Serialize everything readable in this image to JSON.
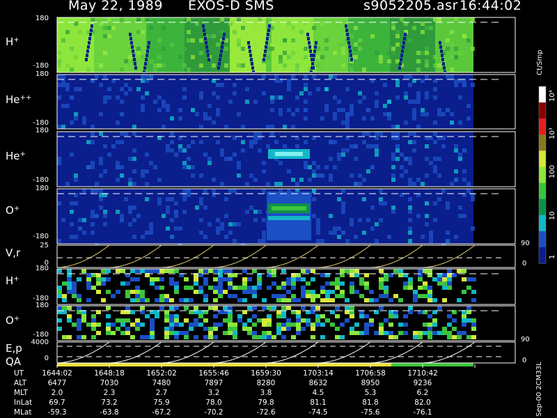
{
  "header": {
    "date": "May 22, 1989",
    "instrument": "EXOS-D SMS",
    "file": "s9052205.asr",
    "time": "16:44:02"
  },
  "panel_labels": {
    "h_plus": "H",
    "h_plus_sup": "+",
    "he_pp": "He",
    "he_pp_sup": "++",
    "he_plus": "He",
    "he_plus_sup": "+",
    "o_plus": "O",
    "o_plus_sup": "+",
    "vr": "V,r",
    "h_plus2": "H",
    "h_plus2_sup": "+",
    "o_plus2": "O",
    "o_plus2_sup": "+",
    "ep": "E,p",
    "qa": "QA"
  },
  "y_ticks": {
    "angle_top": "180",
    "angle_bottom": "-180",
    "vr_top": "25",
    "vr_bottom": "0",
    "ep_top": "4000",
    "ep_bottom": "0",
    "right_90": "90",
    "right_0": "0"
  },
  "colorbar": {
    "unit": "Ct/Smp",
    "labels": [
      "1",
      "10",
      "100",
      "10³",
      "10⁴"
    ],
    "colors": [
      "#0a1e8c",
      "#1b4fc4",
      "#12b7c8",
      "#0f8f4a",
      "#3cc43c",
      "#8ee63c",
      "#d6e83c",
      "#8a7a1e",
      "#e61e1e",
      "#8a0000",
      "#ffffff"
    ]
  },
  "footer": "Sep-00 2CM33L",
  "ephemeris": {
    "labels": [
      "UT",
      "ALT",
      "MLT",
      "InLat",
      "MLat"
    ],
    "columns": [
      {
        "UT": "1644:02",
        "ALT": "6477",
        "MLT": "2.0",
        "InLat": "69.7",
        "MLat": "-59.3"
      },
      {
        "UT": "1648:18",
        "ALT": "7030",
        "MLT": "2.3",
        "InLat": "73.2",
        "MLat": "-63.8"
      },
      {
        "UT": "1652:02",
        "ALT": "7480",
        "MLT": "2.7",
        "InLat": "75.9",
        "MLat": "-67.2"
      },
      {
        "UT": "1655:46",
        "ALT": "7897",
        "MLT": "3.2",
        "InLat": "78.0",
        "MLat": "-70.2"
      },
      {
        "UT": "1659:30",
        "ALT": "8280",
        "MLT": "3.8",
        "InLat": "79.8",
        "MLat": "-72.6"
      },
      {
        "UT": "1703:14",
        "ALT": "8632",
        "MLT": "4.5",
        "InLat": "81.1",
        "MLat": "-74.5"
      },
      {
        "UT": "1706:58",
        "ALT": "8950",
        "MLT": "5.3",
        "InLat": "81.8",
        "MLat": "-75.6"
      },
      {
        "UT": "1710:42",
        "ALT": "9236",
        "MLT": "6.2",
        "InLat": "82.0",
        "MLat": "-76.1"
      }
    ]
  },
  "chart_data": {
    "type": "heatmap",
    "title": "May 22, 1989   EXOS-D SMS",
    "x_ticks": [
      "1644:02",
      "1648:18",
      "1652:02",
      "1655:46",
      "1659:30",
      "1703:14",
      "1706:58",
      "1710:42"
    ],
    "panels": [
      {
        "name": "H+",
        "ylim": [
          -180,
          180
        ],
        "dominant_level": "green",
        "notes": "dark blue diagonal traces repeating each sweep"
      },
      {
        "name": "He++",
        "ylim": [
          -180,
          180
        ],
        "dominant_level": "dark blue"
      },
      {
        "name": "He+",
        "ylim": [
          -180,
          180
        ],
        "dominant_level": "dark blue",
        "notes": "cyan enhancement near 1659:30"
      },
      {
        "name": "O+",
        "ylim": [
          -180,
          180
        ],
        "dominant_level": "dark blue",
        "notes": "green/cyan enhancement near 1659:30"
      },
      {
        "name": "V,r",
        "ylim": [
          0,
          25
        ],
        "right_ylim": [
          0,
          90
        ],
        "type": "line",
        "notes": "sawtooth ramps with dashed reference"
      },
      {
        "name": "H+ (reduced)",
        "ylim": [
          -180,
          180
        ],
        "dominant_level": "banded"
      },
      {
        "name": "O+ (reduced)",
        "ylim": [
          -180,
          180
        ],
        "dominant_level": "banded"
      },
      {
        "name": "E,p",
        "ylim": [
          0,
          4000
        ],
        "right_ylim": [
          0,
          90
        ],
        "type": "line",
        "notes": "sawtooth ramps with dashed reference"
      },
      {
        "name": "QA",
        "segments": [
          {
            "color": "#f0e040",
            "from": "1644:02",
            "to": "1706:58"
          },
          {
            "color": "#3cc43c",
            "from": "1706:58",
            "to": "end"
          }
        ]
      }
    ]
  }
}
